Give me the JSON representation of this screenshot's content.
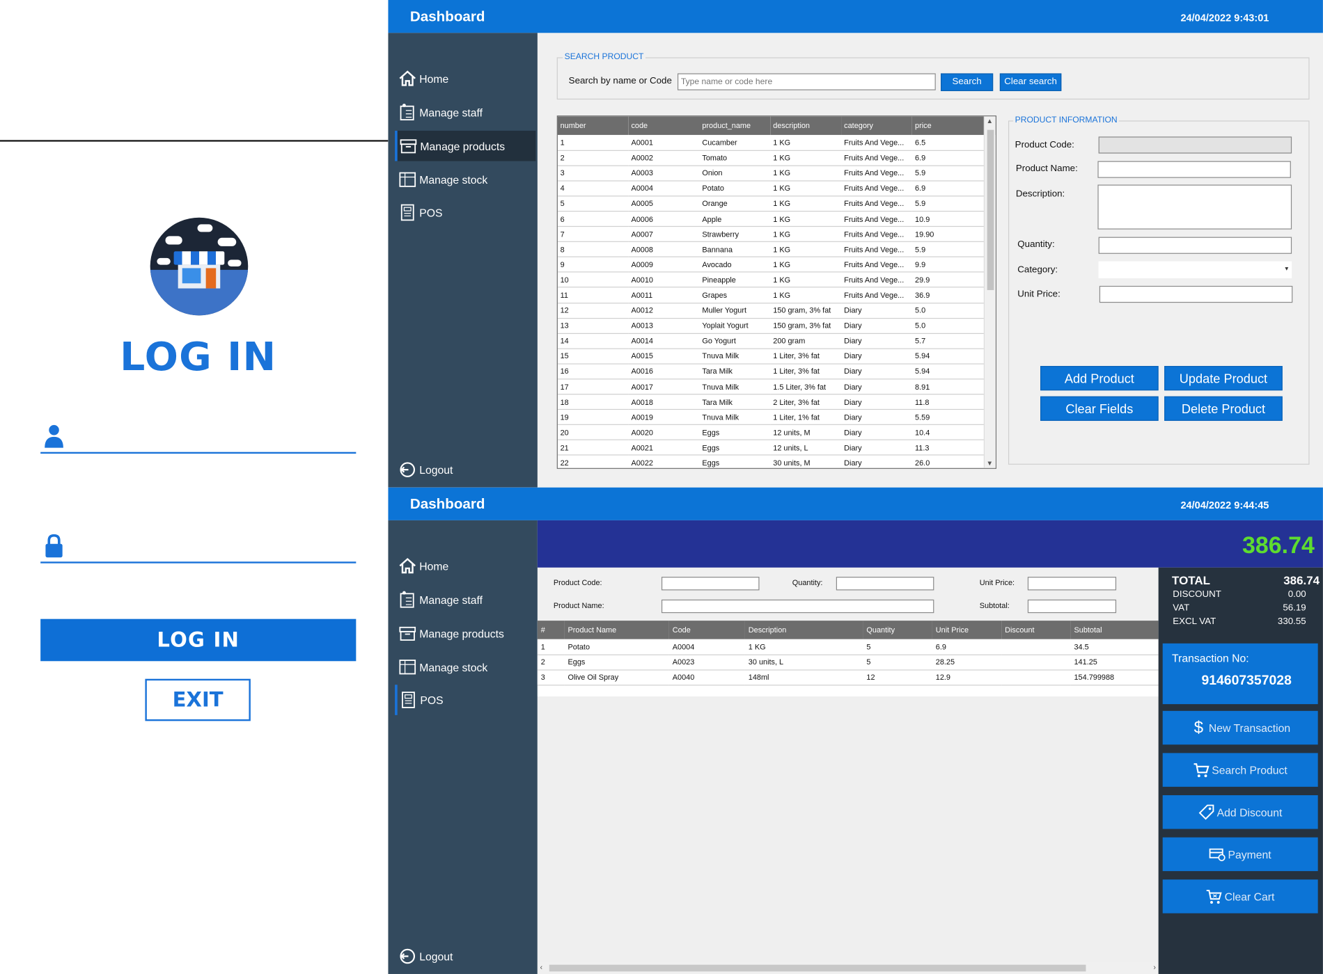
{
  "login": {
    "title": "LOG IN",
    "login_button": "LOG IN",
    "exit_button": "EXIT",
    "username_icon": "user-icon",
    "password_icon": "lock-icon"
  },
  "dash1": {
    "title": "Dashboard",
    "datetime": "24/04/2022 9:43:01",
    "nav": [
      {
        "label": "Home",
        "icon": "home-icon"
      },
      {
        "label": "Manage staff",
        "icon": "staff-icon"
      },
      {
        "label": "Manage products",
        "icon": "products-icon"
      },
      {
        "label": "Manage stock",
        "icon": "stock-icon"
      },
      {
        "label": "POS",
        "icon": "pos-icon"
      }
    ],
    "logout": "Logout",
    "search": {
      "group_label": "SEARCH PRODUCT",
      "label": "Search by name or Code",
      "placeholder": "Type name or code here",
      "search_button": "Search",
      "clear_button": "Clear search"
    },
    "table": {
      "columns": [
        "number",
        "code",
        "product_name",
        "description",
        "category",
        "price"
      ],
      "rows": [
        [
          "1",
          "A0001",
          "Cucamber",
          "1 KG",
          "Fruits And Vege...",
          "6.5"
        ],
        [
          "2",
          "A0002",
          "Tomato",
          "1 KG",
          "Fruits And Vege...",
          "6.9"
        ],
        [
          "3",
          "A0003",
          "Onion",
          "1 KG",
          "Fruits And Vege...",
          "5.9"
        ],
        [
          "4",
          "A0004",
          "Potato",
          "1 KG",
          "Fruits And Vege...",
          "6.9"
        ],
        [
          "5",
          "A0005",
          "Orange",
          "1 KG",
          "Fruits And Vege...",
          "5.9"
        ],
        [
          "6",
          "A0006",
          "Apple",
          "1 KG",
          "Fruits And Vege...",
          "10.9"
        ],
        [
          "7",
          "A0007",
          "Strawberry",
          "1 KG",
          "Fruits And Vege...",
          "19.90"
        ],
        [
          "8",
          "A0008",
          "Bannana",
          "1 KG",
          "Fruits And Vege...",
          "5.9"
        ],
        [
          "9",
          "A0009",
          "Avocado",
          "1 KG",
          "Fruits And Vege...",
          "9.9"
        ],
        [
          "10",
          "A0010",
          "Pineapple",
          "1 KG",
          "Fruits And Vege...",
          "29.9"
        ],
        [
          "11",
          "A0011",
          "Grapes",
          "1 KG",
          "Fruits And Vege...",
          "36.9"
        ],
        [
          "12",
          "A0012",
          "Muller Yogurt",
          "150 gram, 3% fat",
          "Diary",
          "5.0"
        ],
        [
          "13",
          "A0013",
          "Yoplait Yogurt",
          "150 gram, 3% fat",
          "Diary",
          "5.0"
        ],
        [
          "14",
          "A0014",
          "Go Yogurt",
          "200 gram",
          "Diary",
          "5.7"
        ],
        [
          "15",
          "A0015",
          "Tnuva Milk",
          "1 Liter, 3% fat",
          "Diary",
          "5.94"
        ],
        [
          "16",
          "A0016",
          "Tara Milk",
          "1 Liter, 3% fat",
          "Diary",
          "5.94"
        ],
        [
          "17",
          "A0017",
          "Tnuva Milk",
          "1.5 Liter, 3% fat",
          "Diary",
          "8.91"
        ],
        [
          "18",
          "A0018",
          "Tara Milk",
          "2 Liter, 3% fat",
          "Diary",
          "11.8"
        ],
        [
          "19",
          "A0019",
          "Tnuva Milk",
          "1 Liter, 1% fat",
          "Diary",
          "5.59"
        ],
        [
          "20",
          "A0020",
          "Eggs",
          "12 units, M",
          "Diary",
          "10.4"
        ],
        [
          "21",
          "A0021",
          "Eggs",
          "12 units, L",
          "Diary",
          "11.3"
        ],
        [
          "22",
          "A0022",
          "Eggs",
          "30 units, M",
          "Diary",
          "26.0"
        ]
      ]
    },
    "info": {
      "group_label": "PRODUCT INFORMATION",
      "code_label": "Product Code:",
      "name_label": "Product Name:",
      "desc_label": "Description:",
      "qty_label": "Quantity:",
      "cat_label": "Category:",
      "price_label": "Unit Price:",
      "add_button": "Add Product",
      "update_button": "Update Product",
      "clear_button": "Clear Fields",
      "delete_button": "Delete Product"
    }
  },
  "dash2": {
    "title": "Dashboard",
    "datetime": "24/04/2022 9:44:45",
    "nav": [
      {
        "label": "Home",
        "icon": "home-icon"
      },
      {
        "label": "Manage staff",
        "icon": "staff-icon"
      },
      {
        "label": "Manage products",
        "icon": "products-icon"
      },
      {
        "label": "Manage stock",
        "icon": "stock-icon"
      },
      {
        "label": "POS",
        "icon": "pos-icon"
      }
    ],
    "logout": "Logout",
    "big_total": "386.74",
    "form": {
      "code_label": "Product Code:",
      "qty_label": "Quantity:",
      "price_label": "Unit Price:",
      "name_label": "Product Name:",
      "subtotal_label": "Subtotal:"
    },
    "cart": {
      "columns": [
        "#",
        "Product Name",
        "Code",
        "Description",
        "Quantity",
        "Unit Price",
        "Discount",
        "Subtotal"
      ],
      "rows": [
        [
          "1",
          "Potato",
          "A0004",
          "1 KG",
          "5",
          "6.9",
          "",
          "34.5"
        ],
        [
          "2",
          "Eggs",
          "A0023",
          "30 units, L",
          "5",
          "28.25",
          "",
          "141.25"
        ],
        [
          "3",
          "Olive Oil Spray",
          "A0040",
          "148ml",
          "12",
          "12.9",
          "",
          "154.799988"
        ]
      ]
    },
    "summary": {
      "total_label": "TOTAL",
      "total_value": "386.74",
      "discount_label": "DISCOUNT",
      "discount_value": "0.00",
      "vat_label": "VAT",
      "vat_value": "56.19",
      "excl_label": "EXCL VAT",
      "excl_value": "330.55"
    },
    "transaction": {
      "label": "Transaction No:",
      "number": "914607357028"
    },
    "buttons": [
      {
        "label": "New Transaction",
        "icon": "dollar-icon"
      },
      {
        "label": "Search Product",
        "icon": "cart-icon"
      },
      {
        "label": "Add Discount",
        "icon": "tag-icon"
      },
      {
        "label": "Payment",
        "icon": "payment-icon"
      },
      {
        "label": "Clear Cart",
        "icon": "clear-cart-icon"
      }
    ]
  },
  "colors": {
    "accent": "#0c74d6",
    "sidebar": "#334a5e",
    "banner": "#243295",
    "total_green": "#5edc2f"
  }
}
